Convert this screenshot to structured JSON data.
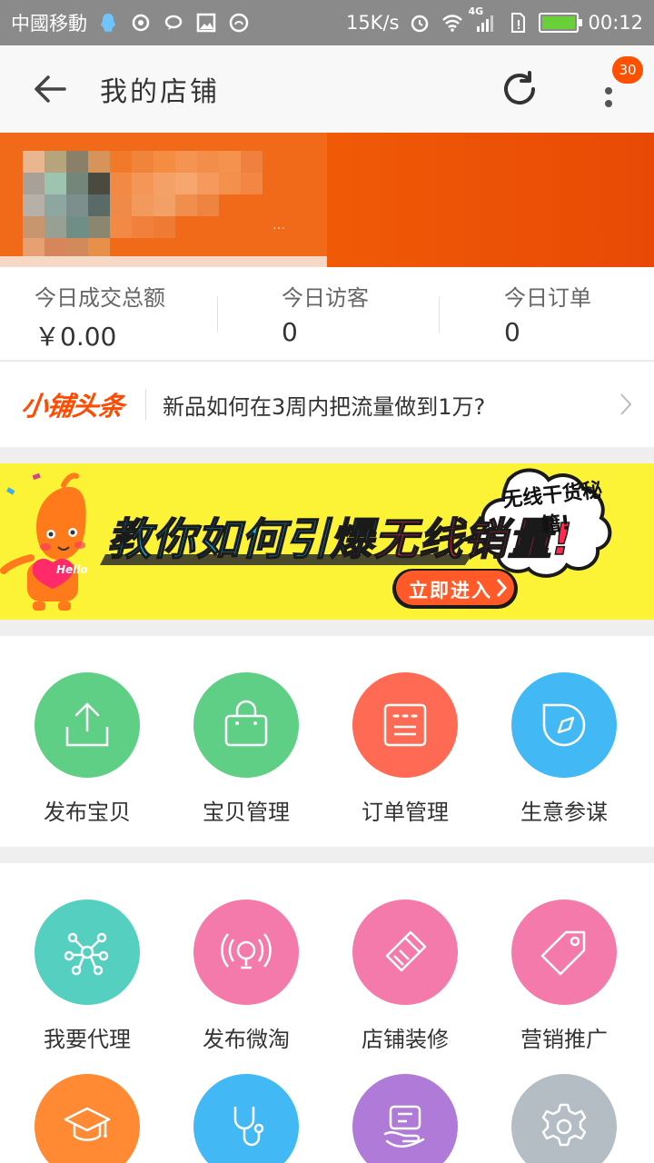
{
  "status_bar": {
    "carrier": "中國移動",
    "net_speed": "15K/s",
    "network": "4G",
    "time": "00:12",
    "icons": [
      "qq-icon",
      "sync-icon",
      "chat-bubble-icon",
      "image-icon",
      "shield-icon",
      "alarm-icon",
      "wifi-icon",
      "signal-icon",
      "sim-icon",
      "battery-icon"
    ]
  },
  "app_bar": {
    "title": "我的店铺",
    "notification_count": "30"
  },
  "stats": [
    {
      "label": "今日成交总额",
      "value": "￥0.00"
    },
    {
      "label": "今日访客",
      "value": "0"
    },
    {
      "label": "今日订单",
      "value": "0"
    }
  ],
  "headline": {
    "logo": "小铺头条",
    "text": "新品如何在3周内把流量做到1万?"
  },
  "promo": {
    "slogan_part1": "教你如何引爆",
    "slogan_part2": "无线销量!",
    "cloud_text": "无线干货秘籍!",
    "cta": "立即进入",
    "mascot_tag": "Hello"
  },
  "grid": [
    {
      "label": "发布宝贝",
      "color": "#5fcf85",
      "icon": "upload-icon"
    },
    {
      "label": "宝贝管理",
      "color": "#5fcf85",
      "icon": "bag-icon"
    },
    {
      "label": "订单管理",
      "color": "#ff6a55",
      "icon": "order-list-icon"
    },
    {
      "label": "生意参谋",
      "color": "#42b9f5",
      "icon": "compass-icon"
    },
    {
      "label": "我要代理",
      "color": "#55d0c0",
      "icon": "network-icon"
    },
    {
      "label": "发布微淘",
      "color": "#f57aac",
      "icon": "broadcast-icon"
    },
    {
      "label": "店铺装修",
      "color": "#f57aac",
      "icon": "brush-icon"
    },
    {
      "label": "营销推广",
      "color": "#f57aac",
      "icon": "tag-icon"
    },
    {
      "label": "",
      "color": "#ff8a33",
      "icon": "graduation-cap-icon"
    },
    {
      "label": "",
      "color": "#42b9f5",
      "icon": "stethoscope-icon"
    },
    {
      "label": "",
      "color": "#b07ad8",
      "icon": "service-hand-icon"
    },
    {
      "label": "",
      "color": "#b4bcc4",
      "icon": "settings-gear-icon"
    }
  ]
}
